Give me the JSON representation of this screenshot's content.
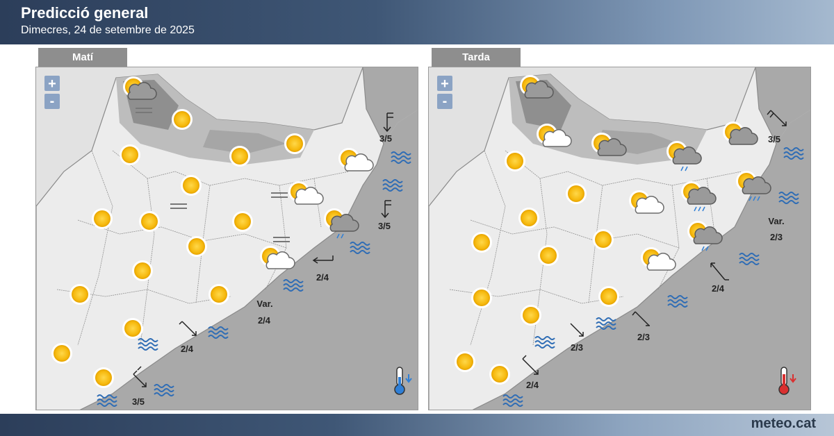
{
  "header": {
    "title": "Predicció general",
    "subtitle": "Dimecres, 24 de setembre de 2025"
  },
  "footer": {
    "brand_main": "meteo",
    "brand_tld": ".cat"
  },
  "colors": {
    "header_dark": "#2c3e5a",
    "tab_gray": "#8e8e8e",
    "sea_wave": "#2f6db5",
    "zoom_blue": "#8ba3c4",
    "thermo_cold": "#2f7fd6",
    "thermo_hot": "#d93030"
  },
  "panels": [
    {
      "id": "mati",
      "label": "Matí",
      "zoom_in": "+",
      "zoom_out": "-",
      "thermometer": "thermometer-falling-icon",
      "symbols": [
        "sun-icon",
        "partly-cloudy-icon",
        "partly-cloudy-rain-icon",
        "fog-icon",
        "sea-wave-icon",
        "wind-arrow-icon"
      ],
      "wind_labels": [
        "3/5",
        "3/5",
        "2/4",
        "Var.",
        "2/4",
        "2/4",
        "3/5"
      ]
    },
    {
      "id": "tarda",
      "label": "Tarda",
      "zoom_in": "+",
      "zoom_out": "-",
      "thermometer": "thermometer-rising-icon",
      "symbols": [
        "sun-icon",
        "partly-cloudy-icon",
        "partly-cloudy-rain-icon",
        "sea-wave-icon",
        "wind-arrow-icon"
      ],
      "wind_labels": [
        "3/5",
        "Var.",
        "2/3",
        "2/4",
        "2/3",
        "2/3",
        "2/4"
      ]
    }
  ]
}
